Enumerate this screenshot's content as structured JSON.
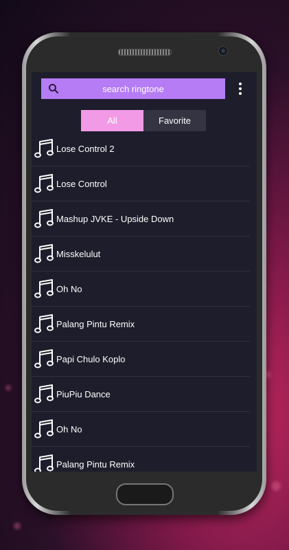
{
  "search": {
    "placeholder": "search ringtone"
  },
  "tabs": [
    {
      "label": "All",
      "active": true
    },
    {
      "label": "Favorite",
      "active": false
    }
  ],
  "ringtones": [
    {
      "title": "Lose Control 2"
    },
    {
      "title": "Lose Control"
    },
    {
      "title": "Mashup JVKE - Upside Down"
    },
    {
      "title": "Misskelulut"
    },
    {
      "title": "Oh No"
    },
    {
      "title": "Palang Pintu Remix"
    },
    {
      "title": "Papi Chulo Koplo"
    },
    {
      "title": "PiuPiu Dance"
    },
    {
      "title": "Oh No"
    },
    {
      "title": "Palang Pintu Remix"
    }
  ],
  "colors": {
    "accent": "#b57cf5",
    "tab_active": "#f29ae6",
    "screen_bg": "#1d1d2b"
  },
  "icons": {
    "search": "search-icon",
    "menu": "more-vertical-icon",
    "row": "music-note-icon"
  }
}
